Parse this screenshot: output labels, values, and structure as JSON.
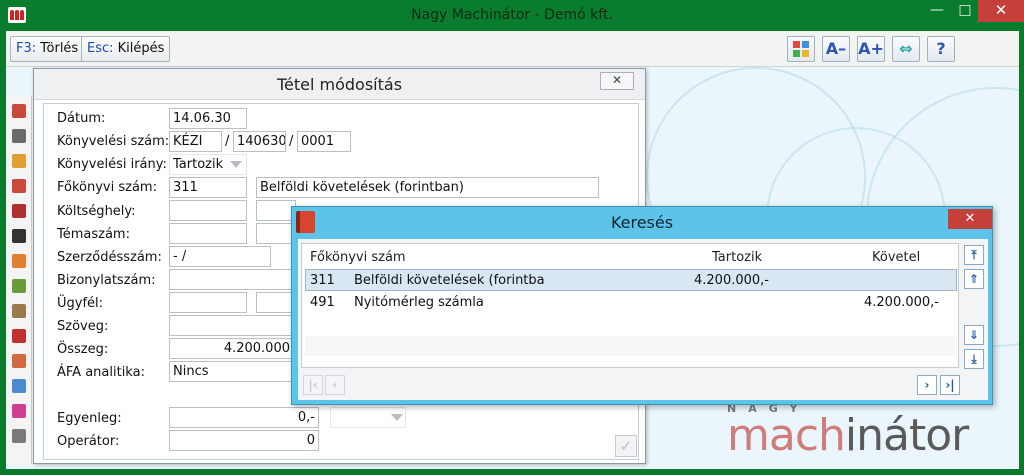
{
  "window": {
    "title": "Nagy Machinátor - Demó kft.",
    "min": "—",
    "max": "□",
    "close": "✕"
  },
  "toolbar": {
    "delete": {
      "key": "F3:",
      "label": "Törlés"
    },
    "exit": {
      "key": "Esc:",
      "label": "Kilépés"
    },
    "icons": [
      "grid-icon",
      "font-decrease-icon",
      "font-increase-icon",
      "resize-icon",
      "help-icon"
    ],
    "icon_glyphs": {
      "decrease": "A–",
      "increase": "A+",
      "resize": "⇔",
      "help": "?"
    }
  },
  "brand": {
    "top": "NAGY",
    "part1": "mach",
    "part2": "inátor"
  },
  "edit_dialog": {
    "title": "Tétel módosítás",
    "close": "✕",
    "labels": {
      "date": "Dátum:",
      "book_number": "Könyvelési szám:",
      "book_direction": "Könyvelési irány:",
      "ledger_number": "Főkönyvi szám:",
      "cost_center": "Költséghely:",
      "topic_number": "Témaszám:",
      "contract_number": "Szerződésszám:",
      "document_number": "Bizonylatszám:",
      "customer": "Ügyfél:",
      "text": "Szöveg:",
      "amount": "Összeg:",
      "vat": "ÁFA analitika:",
      "balance": "Egyenleg:",
      "operator": "Operátor:"
    },
    "values": {
      "date": "14.06.30",
      "book_prefix": "KÉZI",
      "book_middle": "140630",
      "book_suffix": "0001",
      "slash": "/",
      "direction": "Tartozik",
      "ledger_code": "311",
      "ledger_name": "Belföldi követelések (forintban)",
      "contract": "  -   /",
      "amount": "4.200.000",
      "vat": "Nincs",
      "balance": "0,-",
      "operator": "0",
      "ok": "✓"
    }
  },
  "search_dialog": {
    "title": "Keresés",
    "close": "✕",
    "columns": {
      "account": "Főkönyvi szám",
      "debit": "Tartozik",
      "credit": "Követel"
    },
    "rows": [
      {
        "code": "311",
        "name": "Belföldi követelések (forintba",
        "debit": "4.200.000,-",
        "credit": ""
      },
      {
        "code": "491",
        "name": "Nyitómérleg számla",
        "debit": "",
        "credit": "4.200.000,-"
      }
    ],
    "nav": {
      "first": "⤒",
      "prev_page": "⇑",
      "next_page": "⇓",
      "last": "⤓",
      "bottom_first": "|‹",
      "bottom_prev": "‹",
      "bottom_next": "›",
      "bottom_last": "›|"
    }
  }
}
